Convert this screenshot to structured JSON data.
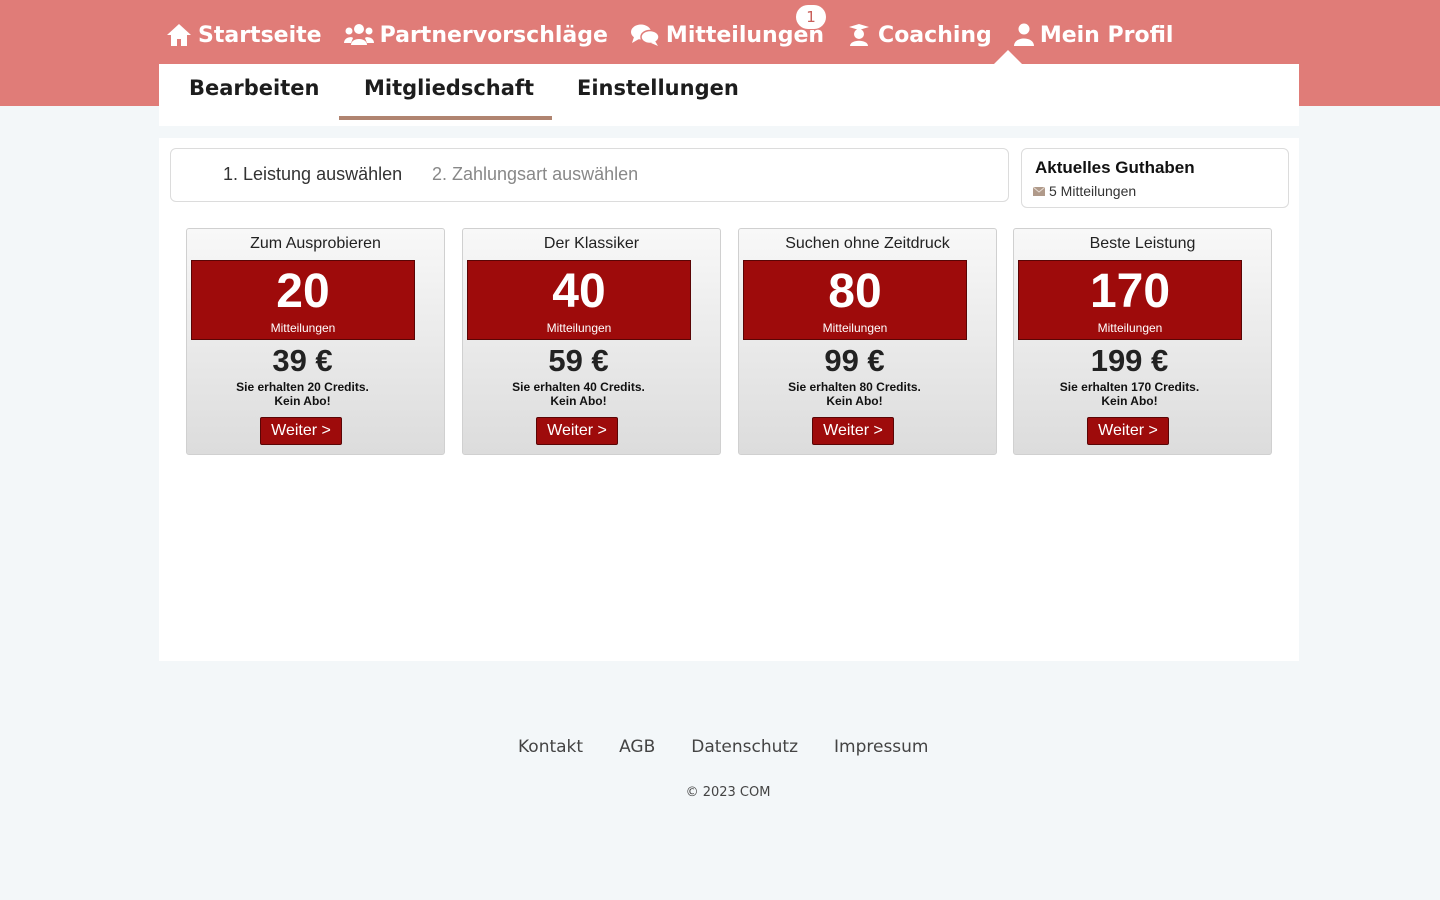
{
  "colors": {
    "header_bg": "#e07c78",
    "accent_red": "#9e0b0b",
    "tab_underline": "#b08470",
    "page_bg": "#f3f7f9"
  },
  "nav": {
    "items": [
      {
        "label": "Startseite",
        "icon": "home-icon"
      },
      {
        "label": "Partnervorschläge",
        "icon": "users-icon"
      },
      {
        "label": "Mitteilungen",
        "icon": "chat-icon",
        "badge": "1"
      },
      {
        "label": "Coaching",
        "icon": "coach-icon"
      },
      {
        "label": "Mein Profil",
        "icon": "user-icon"
      }
    ]
  },
  "tabs": {
    "edit": "Bearbeiten",
    "membership": "Mitgliedschaft",
    "settings": "Einstellungen",
    "active": "Mitgliedschaft"
  },
  "steps": {
    "step1": "1. Leistung auswählen",
    "step2": "2. Zahlungsart auswählen"
  },
  "balance": {
    "title": "Aktuelles Guthaben",
    "icon": "envelope-icon",
    "value": "5 Mitteilungen"
  },
  "packages": [
    {
      "name": "Zum Ausprobieren",
      "count": "20",
      "unit": "Mitteilungen",
      "price": "39 €",
      "note1": "Sie erhalten 20 Credits.",
      "note2": "Kein Abo!",
      "button": "Weiter >"
    },
    {
      "name": "Der Klassiker",
      "count": "40",
      "unit": "Mitteilungen",
      "price": "59 €",
      "note1": "Sie erhalten 40 Credits.",
      "note2": "Kein Abo!",
      "button": "Weiter >"
    },
    {
      "name": "Suchen ohne Zeitdruck",
      "count": "80",
      "unit": "Mitteilungen",
      "price": "99 €",
      "note1": "Sie erhalten 80 Credits.",
      "note2": "Kein Abo!",
      "button": "Weiter >"
    },
    {
      "name": "Beste Leistung",
      "count": "170",
      "unit": "Mitteilungen",
      "price": "199 €",
      "note1": "Sie erhalten 170 Credits.",
      "note2": "Kein Abo!",
      "button": "Weiter >"
    }
  ],
  "footer": {
    "links": [
      "Kontakt",
      "AGB",
      "Datenschutz",
      "Impressum"
    ],
    "copyright": "© 2023 COM"
  }
}
